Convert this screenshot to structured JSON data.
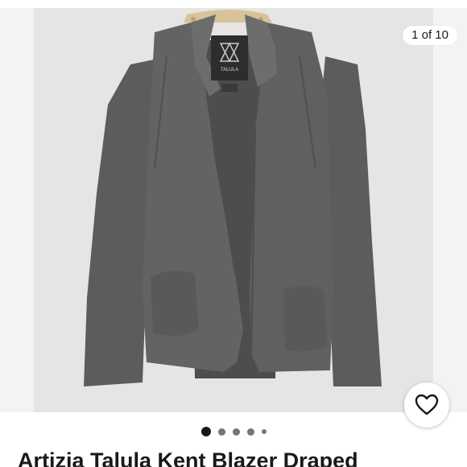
{
  "gallery": {
    "counter": "1 of 10",
    "image_alt": "photo of gray open-front blazer on hanger",
    "brand_tag": "TALULA",
    "dots_count": 5,
    "active_index": 0
  },
  "favorite": {
    "icon": "heart-outline-icon"
  },
  "listing": {
    "title": "Artizia Talula Kent Blazer Draped"
  },
  "colors": {
    "text": "#191919",
    "dot_active": "#191919",
    "dot_inactive": "#757575",
    "jacket": "#5e5f5f"
  }
}
